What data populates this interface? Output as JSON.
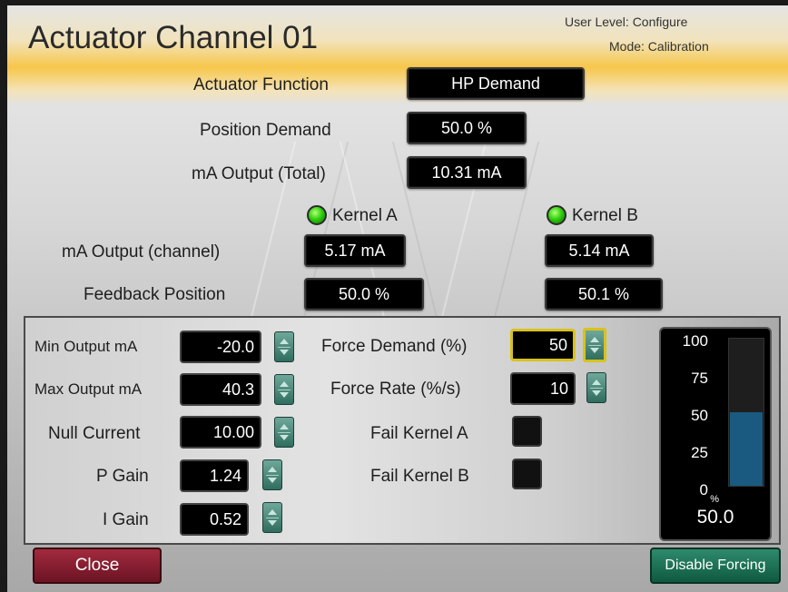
{
  "header": {
    "title": "Actuator Channel 01",
    "user_level": "User Level: Configure",
    "mode": "Mode: Calibration"
  },
  "top": {
    "actuator_function_label": "Actuator Function",
    "actuator_function_value": "HP Demand",
    "position_demand_label": "Position Demand",
    "position_demand_value": "50.0 %",
    "ma_output_total_label": "mA Output (Total)",
    "ma_output_total_value": "10.31 mA"
  },
  "kernels": {
    "kernel_a_label": "Kernel A",
    "kernel_b_label": "Kernel B",
    "kernel_a_status_color": "#31d20f",
    "kernel_b_status_color": "#31d20f",
    "ma_output_channel_label": "mA Output (channel)",
    "ma_output_a": "5.17 mA",
    "ma_output_b": "5.14 mA",
    "feedback_position_label": "Feedback Position",
    "feedback_a": "50.0 %",
    "feedback_b": "50.1 %"
  },
  "settings": {
    "min_output_label": "Min Output mA",
    "min_output_value": "-20.0",
    "max_output_label": "Max Output mA",
    "max_output_value": "40.3",
    "null_current_label": "Null Current",
    "null_current_value": "10.00",
    "p_gain_label": "P Gain",
    "p_gain_value": "1.24",
    "i_gain_label": "I Gain",
    "i_gain_value": "0.52"
  },
  "forcing": {
    "force_demand_label": "Force Demand (%)",
    "force_demand_value": "50",
    "force_rate_label": "Force Rate (%/s)",
    "force_rate_value": "10",
    "fail_kernel_a_label": "Fail Kernel A",
    "fail_kernel_b_label": "Fail Kernel B"
  },
  "gauge": {
    "ticks": [
      "100",
      "75",
      "50",
      "25",
      "0"
    ],
    "unit": "%",
    "value_text": "50.0",
    "level_percent": 50,
    "fill_color": "#1a5a80"
  },
  "buttons": {
    "close_label": "Close",
    "disable_forcing_label": "Disable Forcing"
  },
  "colors": {
    "header_accent": "#f7c74b",
    "close_button": "#8a1f32",
    "disable_forcing_button": "#1a7256",
    "active_field_border": "#d9c21a"
  }
}
